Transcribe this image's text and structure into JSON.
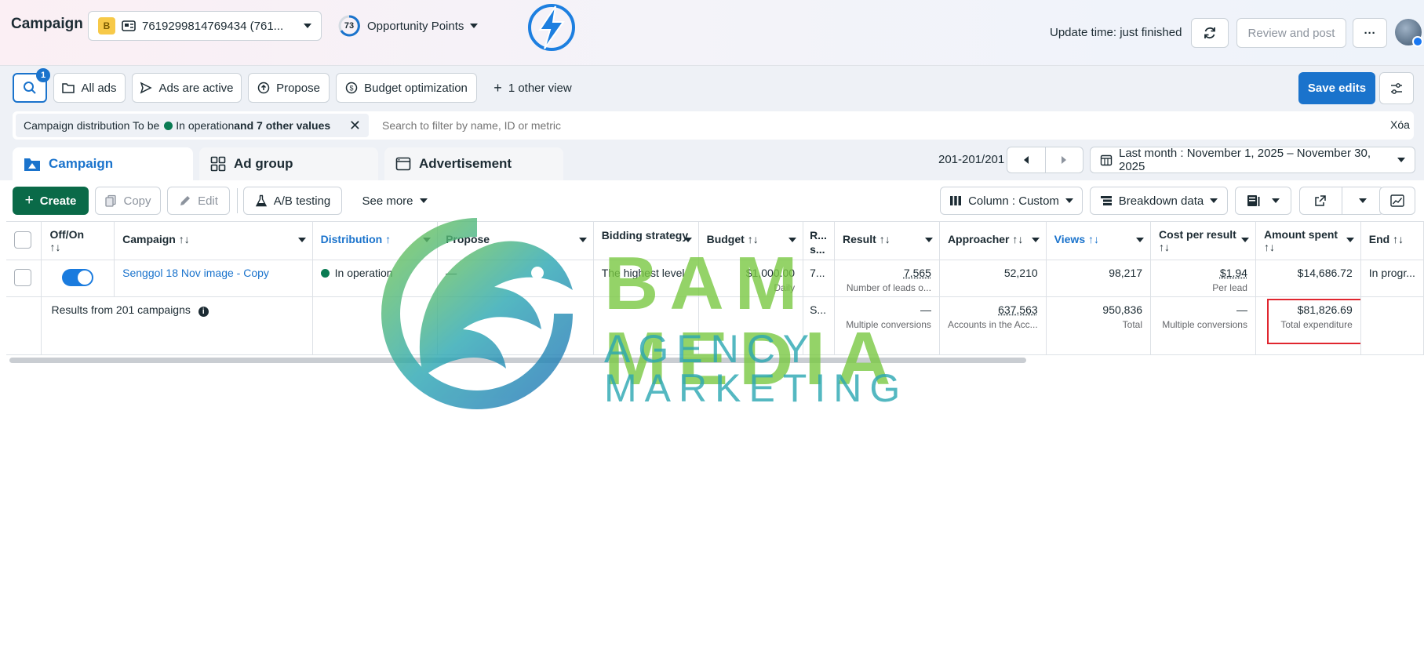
{
  "colors": {
    "primary_blue": "#1a73cc",
    "create_green": "#0a6a48",
    "status_green": "#0a7b53",
    "highlight_red": "#e0262f",
    "watermark_green": "#7ac943",
    "watermark_teal": "#2aa7b2"
  },
  "header": {
    "title": "Campaign",
    "account_badge": "B",
    "account_id": "7619299814769434 (761...",
    "opportunity_score": "73",
    "opportunity_label": "Opportunity Points",
    "update_time": "Update time: just finished",
    "review_post": "Review and post",
    "more_label": "···"
  },
  "views": {
    "search_badge": "1",
    "items": [
      "All ads",
      "Ads are active",
      "Propose",
      "Budget optimization"
    ],
    "other_view": "1 other view",
    "save_edits": "Save edits"
  },
  "filter": {
    "chip_prefix": "Campaign distribution To be",
    "chip_status": "In operation",
    "chip_suffix": "and 7 other values",
    "search_placeholder": "Search to filter by name, ID or metric",
    "clear": "Xóa"
  },
  "tabs": [
    {
      "label": "Campaign",
      "icon": "folder-icon"
    },
    {
      "label": "Ad group",
      "icon": "grid-icon"
    },
    {
      "label": "Advertisement",
      "icon": "ad-icon"
    }
  ],
  "pagination": {
    "range": "201-201/201"
  },
  "date_range": "Last month : November 1, 2025 – November 30, 2025",
  "toolbar": {
    "create": "Create",
    "copy": "Copy",
    "edit": "Edit",
    "ab_testing": "A/B testing",
    "see_more": "See more",
    "column": "Column : Custom",
    "breakdown": "Breakdown data"
  },
  "table": {
    "headers": {
      "off_on": "Off/On",
      "campaign": "Campaign",
      "distribution": "Distribution",
      "propose": "Propose",
      "bidding": "Bidding strategy",
      "budget": "Budget",
      "r": "R... s...",
      "result": "Result",
      "approacher": "Approacher",
      "views": "Views",
      "cost_per_result": "Cost per result",
      "amount_spent": "Amount spent",
      "end": "End"
    },
    "sort_icon": "↑↓",
    "sort_up": "↑",
    "row": {
      "campaign": "Senggol 18 Nov image - Copy",
      "distribution": "In operation",
      "propose": "—",
      "bidding": "The highest level",
      "budget": "$1,000.00",
      "budget_sub": "Daily",
      "r": "7...",
      "result": "7,565",
      "result_sub": "Number of leads o...",
      "approacher": "52,210",
      "views": "98,217",
      "cost": "$1.94",
      "cost_sub": "Per lead",
      "amount": "$14,686.72",
      "end": "In progr..."
    },
    "summary": {
      "label": "Results from 201 campaigns",
      "r": "S...",
      "result": "—",
      "result_sub": "Multiple conversions",
      "approacher": "637,563",
      "approacher_sub": "Accounts in the Acc...",
      "views": "950,836",
      "views_sub": "Total",
      "cost": "—",
      "cost_sub": "Multiple conversions",
      "amount": "$81,826.69",
      "amount_sub": "Total expenditure"
    }
  },
  "watermark": {
    "line1": "BAM MEDIA",
    "line2": "AGENCY MARKETING"
  }
}
